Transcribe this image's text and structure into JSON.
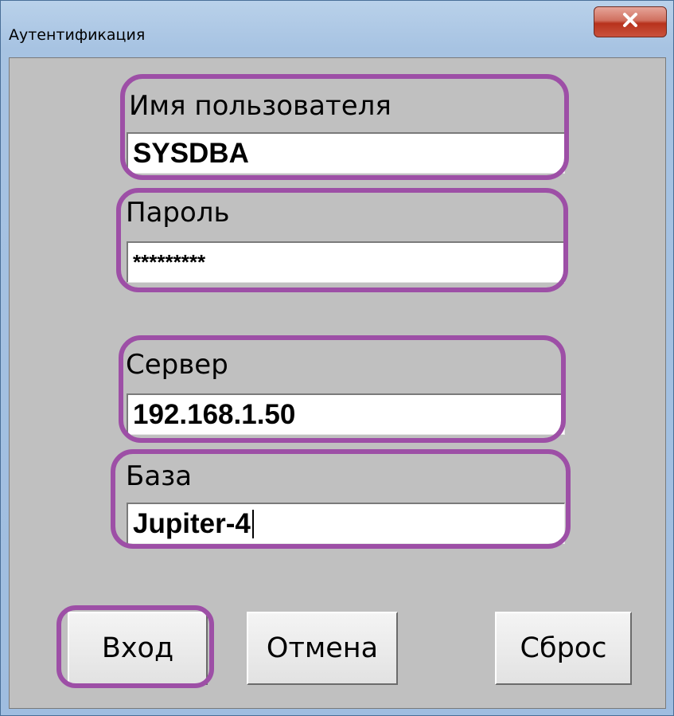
{
  "window": {
    "title": "Аутентификация",
    "close_label": "X"
  },
  "fields": {
    "username": {
      "label": "Имя пользователя",
      "value": "SYSDBA"
    },
    "password": {
      "label": "Пароль",
      "value": "*********"
    },
    "server": {
      "label": "Сервер",
      "value": "192.168.1.50"
    },
    "database": {
      "label": "База",
      "value": "Jupiter-4"
    }
  },
  "buttons": {
    "login": "Вход",
    "cancel": "Отмена",
    "reset": "Сброс"
  },
  "colors": {
    "highlight": "#9d4fa6",
    "dialog_bg": "#c0c0c0",
    "close_button": "#c9523d"
  }
}
